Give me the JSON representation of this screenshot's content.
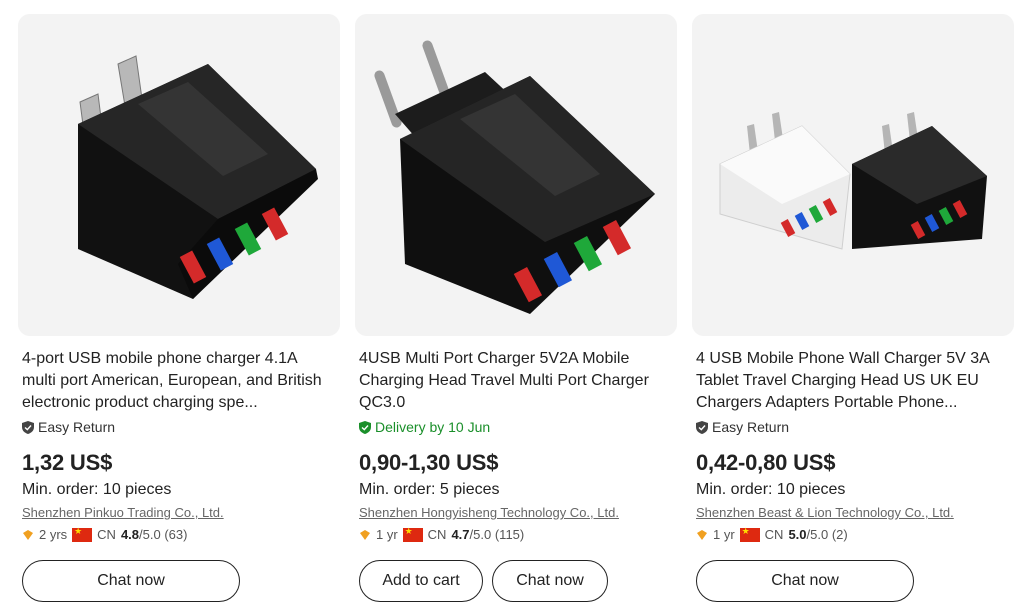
{
  "products": [
    {
      "image_icon": "usb-charger-black-us-plug",
      "title": "4-port USB mobile phone charger 4.1A multi port American, European, and British electronic product charging spe...",
      "badge": "Easy Return",
      "price": "1,32 US$",
      "moq": "Min. order: 10 pieces",
      "supplier": "Shenzhen Pinkuo Trading Co., Ltd.",
      "years": "2 yrs",
      "country": "CN",
      "rating": "4.8",
      "rating_max": "/5.0",
      "reviews": "(63)",
      "buttons": [
        "Chat now"
      ]
    },
    {
      "image_icon": "usb-charger-black-eu-plug",
      "title": "4USB Multi Port Charger 5V2A Mobile Charging Head Travel Multi Port Charger QC3.0",
      "badge": "Delivery by 10 Jun",
      "price": "0,90-1,30 US$",
      "moq": "Min. order: 5 pieces",
      "supplier": "Shenzhen Hongyisheng Technology Co., Ltd.",
      "years": "1 yr",
      "country": "CN",
      "rating": "4.7",
      "rating_max": "/5.0",
      "reviews": "(115)",
      "buttons": [
        "Add to cart",
        "Chat now"
      ]
    },
    {
      "image_icon": "usb-charger-white-and-black-us-plug",
      "title": "4 USB Mobile Phone Wall Charger 5V 3A Tablet Travel Charging Head US UK EU Chargers Adapters Portable Phone...",
      "badge": "Easy Return",
      "price": "0,42-0,80 US$",
      "moq": "Min. order: 10 pieces",
      "supplier": "Shenzhen Beast & Lion Technology Co., Ltd.",
      "years": "1 yr",
      "country": "CN",
      "rating": "5.0",
      "rating_max": "/5.0",
      "reviews": "(2)",
      "buttons": [
        "Chat now"
      ]
    }
  ],
  "colors": {
    "delivery_green": "#1a8f2a",
    "flag_red": "#de2910",
    "gold": "#f0a020"
  }
}
